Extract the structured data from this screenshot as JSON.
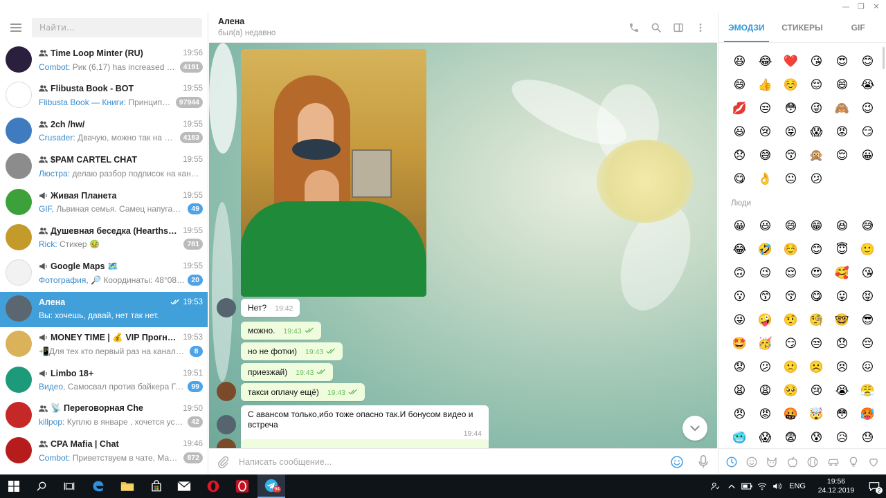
{
  "window": {
    "controls": [
      "minimize",
      "restore",
      "close"
    ]
  },
  "sidebar": {
    "search_placeholder": "Найти...",
    "chats": [
      {
        "name": "Time Loop Minter (RU)",
        "type": "group",
        "time": "19:56",
        "sender": "Combot:",
        "preview": " Рик (6.17) has increased rep...",
        "badge": "4191",
        "badge_active": false,
        "avatar_color": "#2a1f3d"
      },
      {
        "name": "Flibusta Book - BOT",
        "type": "group",
        "time": "19:55",
        "sender": "Flibusta Book — Книги:",
        "preview": " Принципы. ...",
        "badge": "97944",
        "badge_active": false,
        "avatar_color": "#ffffff"
      },
      {
        "name": "2ch /hw/",
        "type": "group",
        "time": "19:55",
        "sender": "Crusader:",
        "preview": " Двачую, можно так на вое...",
        "badge": "4183",
        "badge_active": false,
        "avatar_color": "#3f7cbf"
      },
      {
        "name": "$PAM CARTEL CHAT",
        "type": "group",
        "time": "19:55",
        "sender": "Люстра:",
        "preview": " делаю разбор подписок на каналы",
        "badge": "",
        "badge_active": false,
        "avatar_color": "#8c8c8c"
      },
      {
        "name": "Живая Планета",
        "type": "channel",
        "time": "19:55",
        "sender": "GIF,",
        "preview": " Львиная семья. Самец напугал сам...",
        "badge": "49",
        "badge_active": true,
        "avatar_color": "#3ca13a"
      },
      {
        "name": "Душевная беседка (Hearthstone)",
        "type": "group",
        "time": "19:55",
        "sender": "Rick:",
        "preview": " Стикер 🤢",
        "badge": "781",
        "badge_active": false,
        "avatar_color": "#c49a2a"
      },
      {
        "name": "Google Maps 🗺️",
        "type": "channel",
        "time": "19:55",
        "sender": "Фотография,",
        "preview": " 🔎 Координаты: 48°08'34...",
        "badge": "20",
        "badge_active": true,
        "avatar_color": "#f2f2f2"
      },
      {
        "name": "Алена",
        "type": "user",
        "time": "19:53",
        "sender": "",
        "preview": "Вы: хочешь, давай, нет так нет.",
        "badge": "",
        "badge_active": false,
        "avatar_color": "#5b6770",
        "selected": true
      },
      {
        "name": "MONEY TIME | 💰 VIP Прогнозы...",
        "type": "channel",
        "time": "19:53",
        "sender": "",
        "preview": "📲Для тех кто первый раз на канале...",
        "badge": "8",
        "badge_active": true,
        "avatar_color": "#d9b25a"
      },
      {
        "name": "Limbo 18+",
        "type": "channel",
        "time": "19:51",
        "sender": "Видео,",
        "preview": " Самосвал против байкера  Груз...",
        "badge": "99",
        "badge_active": true,
        "avatar_color": "#1d9a7a"
      },
      {
        "name": "📡 Переговорная Che",
        "type": "group",
        "time": "19:50",
        "sender": "killpop:",
        "preview": " Куплю в январе , хочется услы...",
        "badge": "42",
        "badge_active": false,
        "avatar_color": "#c62828"
      },
      {
        "name": "CPA Mafia | Chat",
        "type": "group",
        "time": "19:46",
        "sender": "Combot:",
        "preview": " Приветствуем в чате, Мафио...",
        "badge": "872",
        "badge_active": false,
        "avatar_color": "#b71c1c"
      }
    ]
  },
  "header": {
    "name": "Алена",
    "status": "был(а) недавно"
  },
  "messages": {
    "m1": {
      "text": "Нет?",
      "time": "19:42"
    },
    "m2": {
      "text": "можно.",
      "time": "19:43"
    },
    "m3": {
      "text": "но не фотки)",
      "time": "19:43"
    },
    "m4": {
      "text": "приезжай)",
      "time": "19:43"
    },
    "m5": {
      "text": "такси оплачу ещё)",
      "time": "19:43"
    },
    "m6": {
      "text": "С авансом только,ибо тоже опасно так.И бонусом видео и встреча",
      "time": "19:44"
    }
  },
  "compose": {
    "placeholder": "Написать сообщение..."
  },
  "emoji_panel": {
    "tabs": [
      "ЭМОДЗИ",
      "СТИКЕРЫ",
      "GIF"
    ],
    "recent": [
      "😆",
      "😂",
      "❤️",
      "😘",
      "😍",
      "😊",
      "😄",
      "👍",
      "☺️",
      "😌",
      "😄",
      "😭",
      "💋",
      "😒",
      "😳",
      "😜",
      "🙈",
      "😉",
      "😃",
      "😢",
      "😝",
      "😱",
      "😡",
      "😏",
      "😞",
      "😅",
      "😚",
      "🙊",
      "😌",
      "😀",
      "😋",
      "👌",
      "😐",
      "😕"
    ],
    "section_people": "Люди",
    "people": [
      "😀",
      "😃",
      "😄",
      "😁",
      "😆",
      "😅",
      "😂",
      "🤣",
      "☺️",
      "😊",
      "😇",
      "🙂",
      "🙃",
      "😉",
      "😌",
      "😍",
      "🥰",
      "😘",
      "😗",
      "😙",
      "😚",
      "😋",
      "😛",
      "😝",
      "😜",
      "🤪",
      "🤨",
      "🧐",
      "🤓",
      "😎",
      "🤩",
      "🥳",
      "😏",
      "😒",
      "😞",
      "😔",
      "😟",
      "😕",
      "🙁",
      "☹️",
      "😣",
      "😖",
      "😫",
      "😩",
      "🥺",
      "😢",
      "😭",
      "😤",
      "😠",
      "😡",
      "🤬",
      "🤯",
      "😳",
      "🥵",
      "🥶",
      "😱",
      "😨",
      "😰",
      "😥",
      "😓"
    ],
    "categories": [
      "recent-clock-icon",
      "smile-icon",
      "cat-icon",
      "apple-icon",
      "ball-icon",
      "car-icon",
      "bulb-icon",
      "heart-icon"
    ]
  },
  "taskbar": {
    "lang": "ENG",
    "time": "19:56",
    "date": "24.12.2019",
    "notification_count": "2",
    "telegram_badge": "94"
  }
}
